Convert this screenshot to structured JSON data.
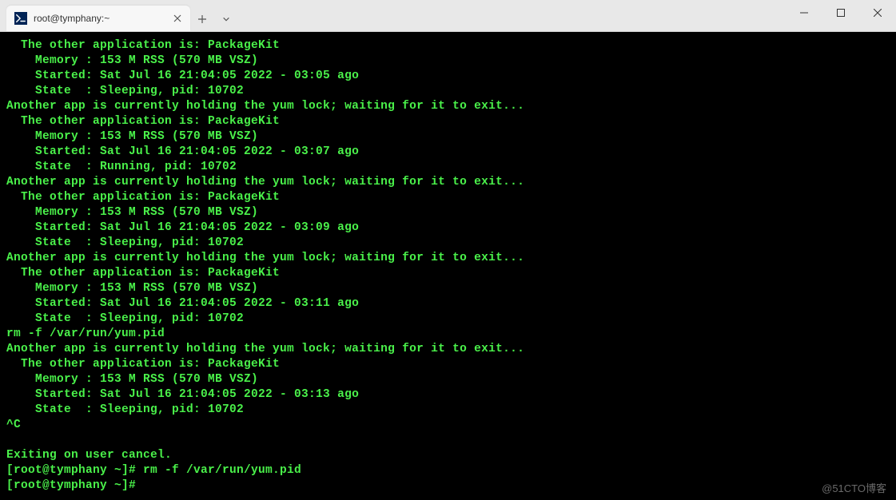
{
  "tab": {
    "title": "root@tymphany:~"
  },
  "terminal": {
    "lines": [
      "  The other application is: PackageKit",
      "    Memory : 153 M RSS (570 MB VSZ)",
      "    Started: Sat Jul 16 21:04:05 2022 - 03:05 ago",
      "    State  : Sleeping, pid: 10702",
      "Another app is currently holding the yum lock; waiting for it to exit...",
      "  The other application is: PackageKit",
      "    Memory : 153 M RSS (570 MB VSZ)",
      "    Started: Sat Jul 16 21:04:05 2022 - 03:07 ago",
      "    State  : Running, pid: 10702",
      "Another app is currently holding the yum lock; waiting for it to exit...",
      "  The other application is: PackageKit",
      "    Memory : 153 M RSS (570 MB VSZ)",
      "    Started: Sat Jul 16 21:04:05 2022 - 03:09 ago",
      "    State  : Sleeping, pid: 10702",
      "Another app is currently holding the yum lock; waiting for it to exit...",
      "  The other application is: PackageKit",
      "    Memory : 153 M RSS (570 MB VSZ)",
      "    Started: Sat Jul 16 21:04:05 2022 - 03:11 ago",
      "    State  : Sleeping, pid: 10702",
      "rm -f /var/run/yum.pid",
      "Another app is currently holding the yum lock; waiting for it to exit...",
      "  The other application is: PackageKit",
      "    Memory : 153 M RSS (570 MB VSZ)",
      "    Started: Sat Jul 16 21:04:05 2022 - 03:13 ago",
      "    State  : Sleeping, pid: 10702",
      "^C",
      "",
      "Exiting on user cancel.",
      "[root@tymphany ~]# rm -f /var/run/yum.pid",
      "[root@tymphany ~]# "
    ]
  },
  "watermark": "@51CTO博客"
}
